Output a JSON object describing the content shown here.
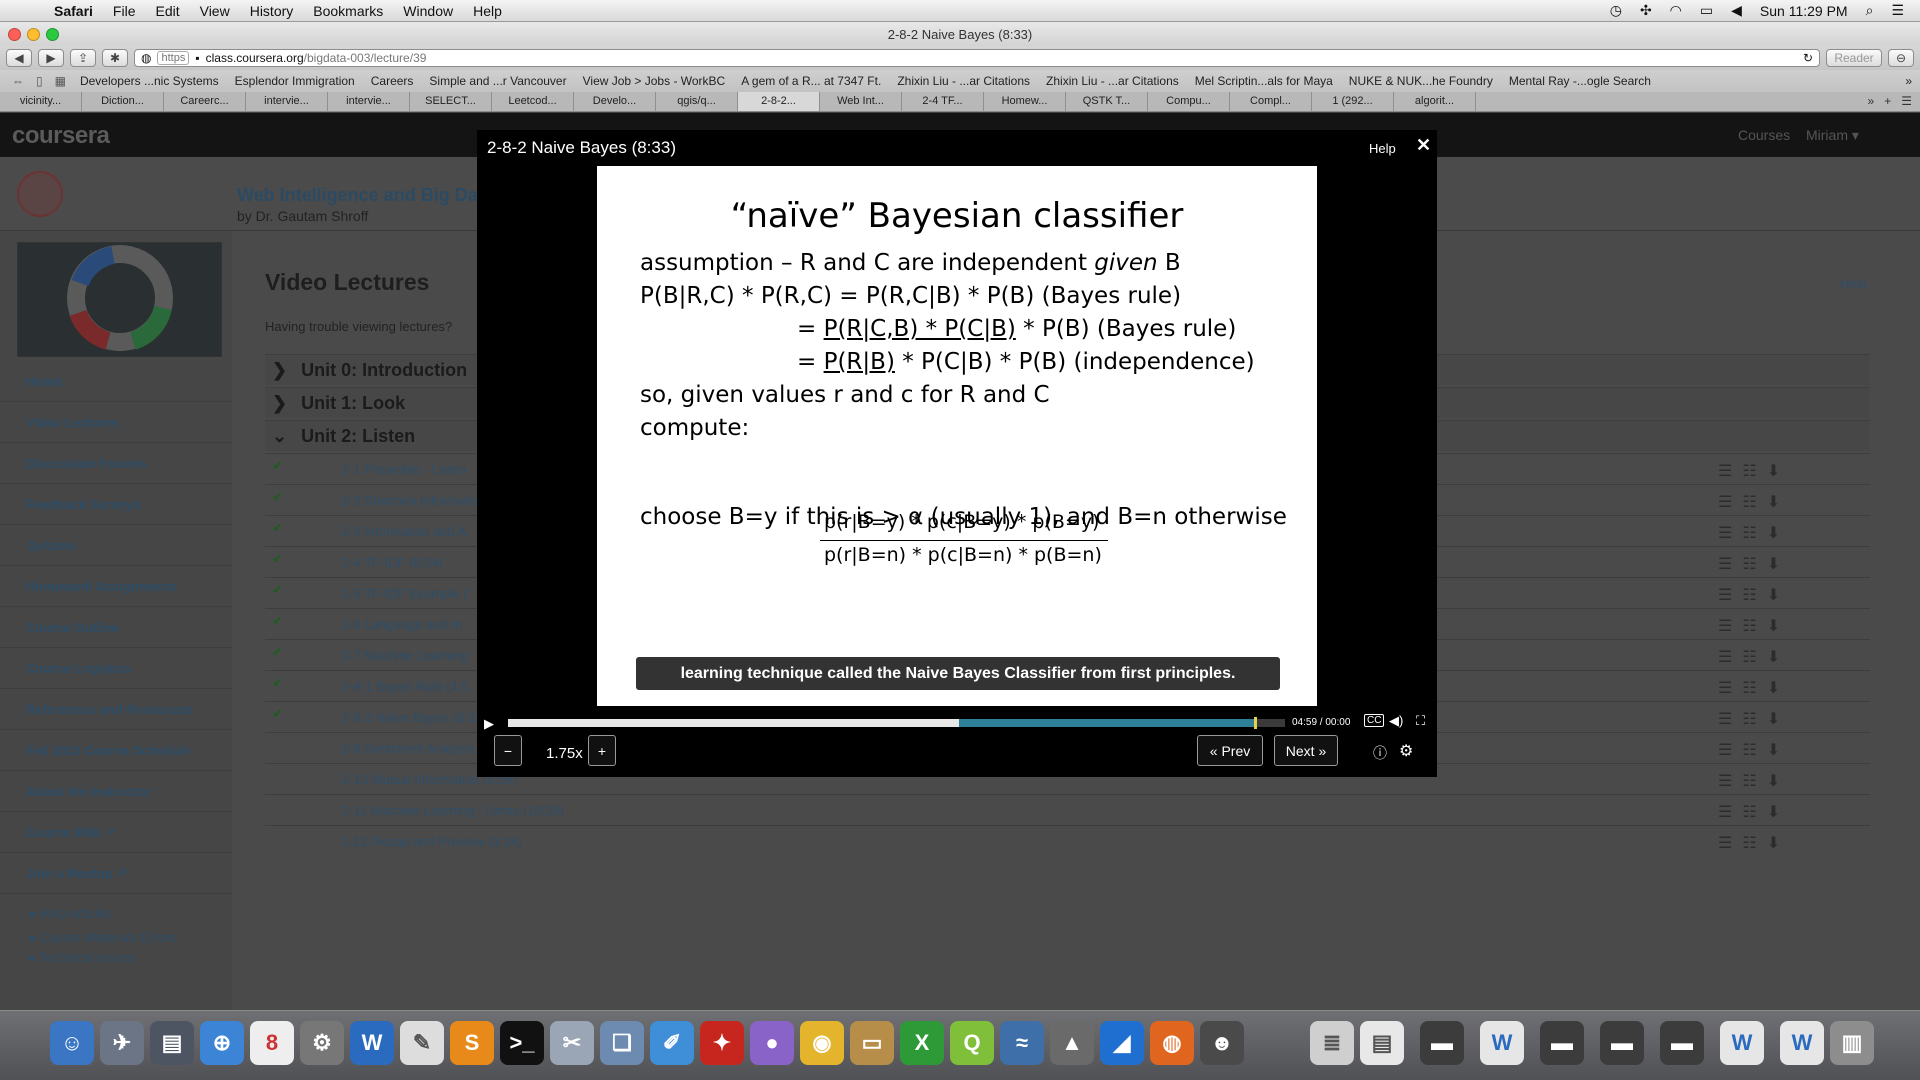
{
  "menubar": {
    "items": [
      "Safari",
      "File",
      "Edit",
      "View",
      "History",
      "Bookmarks",
      "Window",
      "Help"
    ],
    "clock": "Sun 11:29 PM"
  },
  "window": {
    "title": "2-8-2 Naive Bayes (8:33)"
  },
  "toolbar": {
    "scheme": "https",
    "host": "class.coursera.org",
    "path": "/bigdata-003/lecture/39",
    "reader_label": "Reader"
  },
  "bookmarks": [
    "Developers ...nic Systems",
    "Esplendor Immigration",
    "Careers",
    "Simple and ...r Vancouver",
    "View Job > Jobs - WorkBC",
    "A gem of a R... at 7347 Ft.",
    "Zhixin Liu - ...ar Citations",
    "Zhixin Liu - ...ar Citations",
    "Mel Scriptin...als for Maya",
    "NUKE & NUK...he Foundry",
    "Mental Ray -...ogle Search"
  ],
  "tabs": [
    "vicinity...",
    "Diction...",
    "Careerc...",
    "intervie...",
    "intervie...",
    "SELECT...",
    "Leetcod...",
    "Develo...",
    "qgis/q...",
    "2-8-2...",
    "Web Int...",
    "2-4 TF...",
    "Homew...",
    "QSTK T...",
    "Compu...",
    "Compl...",
    "1 (292...",
    "algorit..."
  ],
  "coursera": {
    "logo": "coursera",
    "courses_label": "Courses",
    "user_label": "Miriam",
    "course_title": "Web Intelligence and Big Da",
    "course_by": "by Dr. Gautam Shroff",
    "page_title": "Video Lectures",
    "trouble": "Having trouble viewing lectures?",
    "help": "Help",
    "nav": [
      "Home",
      "Video Lectures",
      "Discussion Forums",
      "Feedback Surveys",
      "Quizzes",
      "Homework Assignments",
      "Course Outline",
      "Course Logistics",
      "References and Resources",
      "Fall 2013 Course Schedule",
      "About the Instructor",
      "Course Wiki",
      "Join a Meetup"
    ],
    "footer_links": [
      "Help Articles",
      "Course Materials Errors",
      "Technical Issues"
    ],
    "units": [
      "Unit 0: Introduction",
      "Unit 1: Look",
      "Unit 2: Listen"
    ],
    "lectures": [
      {
        "title": "2-1 Preamble - Listen",
        "done": true
      },
      {
        "title": "2-2 Shannon Information",
        "done": true
      },
      {
        "title": "2-3 Information and A",
        "done": true
      },
      {
        "title": "2-4 TF-IDF (8:24)",
        "done": true
      },
      {
        "title": "2-5 TF-IDF Example (",
        "done": true
      },
      {
        "title": "2-6 Language and In",
        "done": true
      },
      {
        "title": "2-7 Machine Learning",
        "done": true
      },
      {
        "title": "2-8-1 Bayes Rule (4:5",
        "done": true
      },
      {
        "title": "2-8-2 Naive Bayes (8:33)",
        "done": true
      },
      {
        "title": "2-9 Sentiment Analysis (7:32)",
        "done": false
      },
      {
        "title": "2-10 Mutual Information (8:58)",
        "done": false
      },
      {
        "title": "2-11 Machine Learning - Limits (10:29)",
        "done": false
      },
      {
        "title": "2-12 Recap and Preview (3:14)",
        "done": false
      }
    ]
  },
  "modal": {
    "title": "2-8-2 Naive Bayes (8:33)",
    "help": "Help",
    "slide": {
      "title": "“naïve” Bayesian classifier",
      "l1a": "assumption – R and C are independent ",
      "l1b": "given",
      "l1c": " B",
      "l2": "P(B|R,C) * P(R,C) = P(R,C|B) * P(B) (Bayes rule)",
      "l3a": "= ",
      "l3b": "P(R|C,B) * P(C|B)",
      "l3c": " * P(B) (Bayes rule)",
      "l4a": "= ",
      "l4b": "P(R|B)",
      "l4c": " * P(C|B) * P(B) (independence)",
      "l5": "so, given values r and c for R and C",
      "l6": "compute:",
      "num": "p(r|B=y) * p(c|B=y) * p(B=y)",
      "den": "p(r|B=n) * p(c|B=n) * p(B=n)",
      "l7": "choose B=y if this is > α (usually 1), and B=n otherwise"
    },
    "caption": "learning technique called the Naive Bayes Classifier from first principles.",
    "time": "04:59 / 00:00",
    "rate": "1.75x",
    "prev": "« Prev",
    "next": "Next »",
    "buffered_fraction": 0.58,
    "played_fraction": 0.96
  }
}
